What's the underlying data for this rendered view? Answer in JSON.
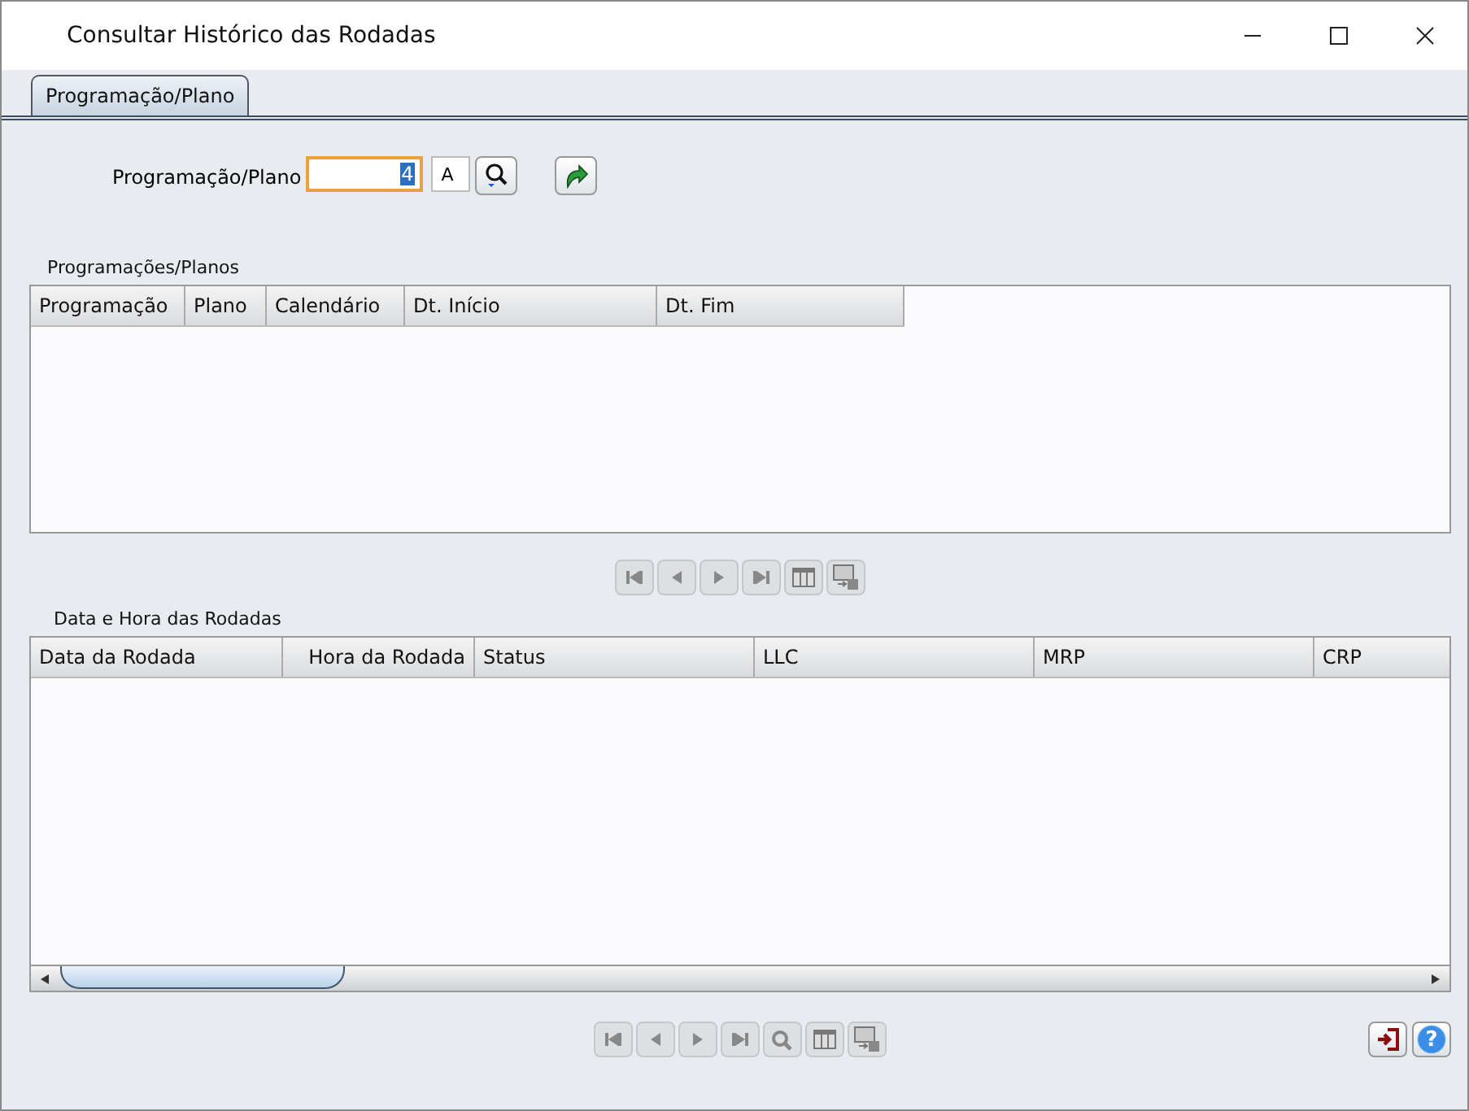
{
  "window": {
    "title": "Consultar Histórico das Rodadas"
  },
  "tabs": [
    {
      "label": "Programação/Plano",
      "selected": true
    }
  ],
  "filter": {
    "label": "Programação/Plano",
    "value": "4",
    "suffix": "A"
  },
  "plans_table": {
    "title": "Programações/Planos",
    "columns": [
      "Programação",
      "Plano",
      "Calendário",
      "Dt. Início",
      "Dt. Fim"
    ]
  },
  "plans_nav": [
    {
      "kind": "first",
      "disabled": true
    },
    {
      "kind": "prev",
      "disabled": true
    },
    {
      "kind": "next",
      "disabled": true
    },
    {
      "kind": "last",
      "disabled": true
    },
    {
      "kind": "grid",
      "disabled": true
    },
    {
      "kind": "export",
      "disabled": true
    }
  ],
  "runs_table": {
    "title": "Data e Hora das Rodadas",
    "columns": [
      "Data da Rodada",
      "Hora da Rodada",
      "Status",
      "LLC",
      "MRP",
      "CRP"
    ]
  },
  "runs_nav": [
    {
      "kind": "first",
      "disabled": true
    },
    {
      "kind": "prev",
      "disabled": true
    },
    {
      "kind": "next",
      "disabled": true
    },
    {
      "kind": "last",
      "disabled": true
    },
    {
      "kind": "search",
      "disabled": true
    },
    {
      "kind": "grid",
      "disabled": true
    },
    {
      "kind": "export",
      "disabled": true
    }
  ],
  "help_button": {
    "label": "?"
  }
}
